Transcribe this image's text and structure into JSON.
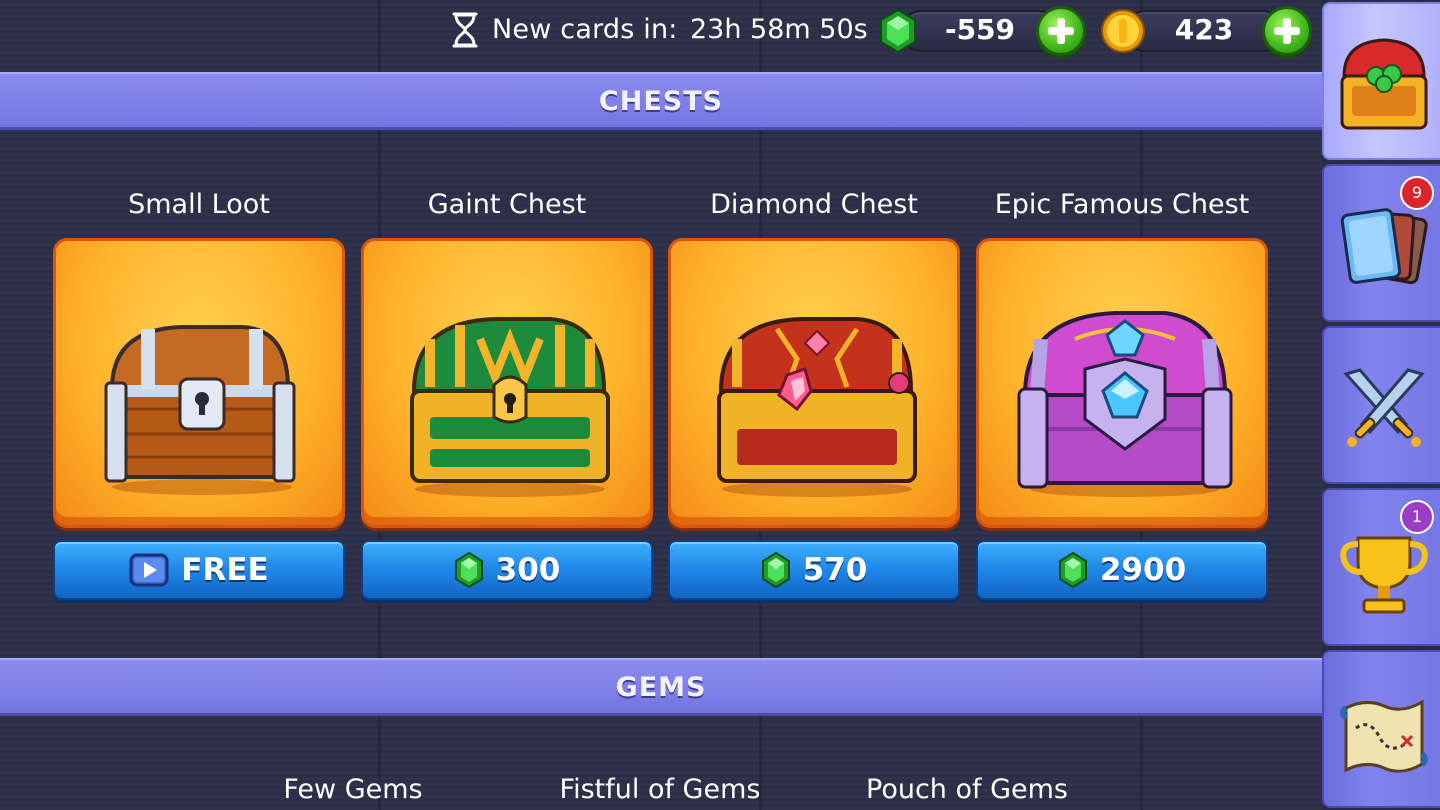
{
  "topbar": {
    "timer_label": "New cards in:",
    "timer_value": "23h 58m 50s",
    "gems_value": "-559",
    "coins_value": "423"
  },
  "sections": {
    "chests_title": "CHESTS",
    "gems_title": "GEMS"
  },
  "chests": [
    {
      "title": "Small Loot",
      "price": "FREE",
      "price_icon": "play-video-icon",
      "chest_icon": "wooden-chest-icon"
    },
    {
      "title": "Gaint Chest",
      "price": "300",
      "price_icon": "gem-icon",
      "chest_icon": "green-gold-chest-icon"
    },
    {
      "title": "Diamond Chest",
      "price": "570",
      "price_icon": "gem-icon",
      "chest_icon": "red-gold-chest-icon"
    },
    {
      "title": "Epic Famous Chest",
      "price": "2900",
      "price_icon": "gem-icon",
      "chest_icon": "purple-chest-icon"
    }
  ],
  "gems": [
    {
      "title": "Few Gems"
    },
    {
      "title": "Fistful of Gems"
    },
    {
      "title": "Pouch of Gems"
    }
  ],
  "sidebar": {
    "tabs": [
      {
        "name": "shop",
        "icon": "treasure-chest-icon",
        "active": true
      },
      {
        "name": "cards",
        "icon": "cards-icon",
        "badge": "9",
        "badge_color": "#d9262b"
      },
      {
        "name": "battle",
        "icon": "crossed-swords-icon"
      },
      {
        "name": "trophies",
        "icon": "trophy-icon",
        "badge": "1",
        "badge_color": "#9b3cc6"
      },
      {
        "name": "map",
        "icon": "treasure-map-icon"
      }
    ]
  },
  "colors": {
    "header_bg": "#7c7de8",
    "button_blue": "#1f86e8",
    "card_orange": "#ffb42d",
    "gem_green": "#2fc43a",
    "coin_gold": "#f7c21b"
  }
}
